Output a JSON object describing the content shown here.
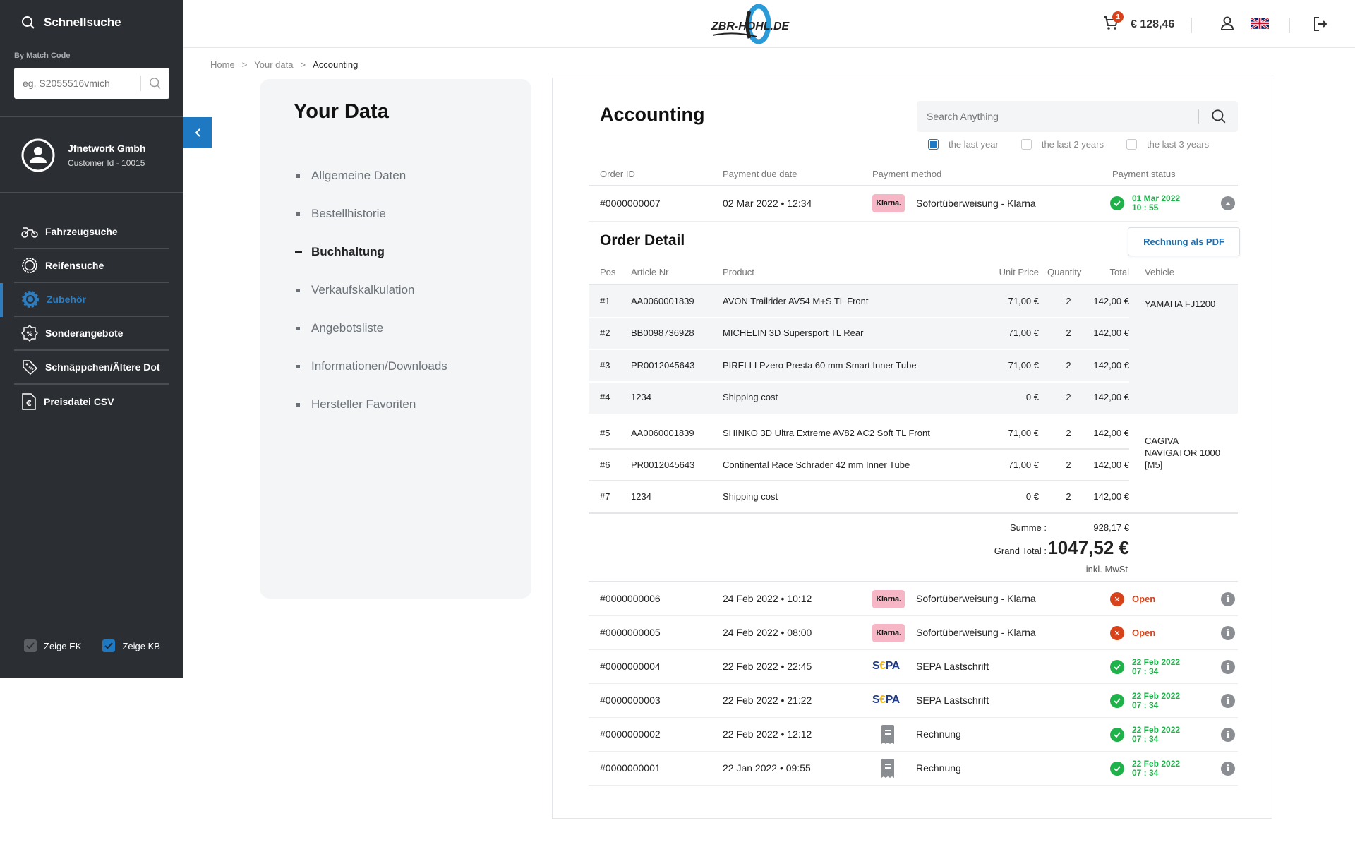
{
  "sidebar": {
    "search_title": "Schnellsuche",
    "match_label": "By Match Code",
    "match_placeholder": "eg. S2055516vmich",
    "profile": {
      "name": "Jfnetwork Gmbh",
      "customer_id": "Customer Id - 10015"
    },
    "nav": [
      {
        "label": "Fahrzeugsuche",
        "icon": "motorcycle-icon",
        "active": false
      },
      {
        "label": "Reifensuche",
        "icon": "tire-icon",
        "active": false
      },
      {
        "label": "Zubehör",
        "icon": "gear-wrench-icon",
        "active": true
      },
      {
        "label": "Sonderangebote",
        "icon": "discount-badge-icon",
        "active": false
      },
      {
        "label": "Schnäppchen/Ältere Dot",
        "icon": "price-tag-icon",
        "active": false
      },
      {
        "label": "Preisdatei CSV",
        "icon": "euro-file-icon",
        "active": false
      }
    ],
    "checkboxes": [
      {
        "label": "Zeige EK",
        "checked": true,
        "color": "#5b5e63"
      },
      {
        "label": "Zeige KB",
        "checked": true,
        "color": "#1e78c2"
      }
    ]
  },
  "header": {
    "logo_text": "ZBR-HOHL.DE",
    "cart_count": "1",
    "cart_amount": "€ 128,46"
  },
  "breadcrumb": [
    "Home",
    "Your data",
    "Accounting"
  ],
  "your_data": {
    "title": "Your Data",
    "menu": [
      {
        "label": "Allgemeine Daten",
        "active": false
      },
      {
        "label": "Bestellhistorie",
        "active": false
      },
      {
        "label": "Buchhaltung",
        "active": true
      },
      {
        "label": "Verkaufskalkulation",
        "active": false
      },
      {
        "label": "Angebotsliste",
        "active": false
      },
      {
        "label": "Informationen/Downloads",
        "active": false
      },
      {
        "label": "Hersteller Favoriten",
        "active": false
      }
    ]
  },
  "accounting": {
    "title": "Accounting",
    "search_placeholder": "Search Anything",
    "filters": [
      {
        "label": "the last year",
        "checked": true
      },
      {
        "label": "the last 2 years",
        "checked": false
      },
      {
        "label": "the last 3 years",
        "checked": false
      }
    ],
    "columns": [
      "Order ID",
      "Payment due date",
      "Payment method",
      "Payment status"
    ],
    "expanded_order": {
      "id": "#0000000007",
      "due": "02 Mar 2022 • 12:34",
      "method_logo": "Klarna.",
      "method": "Sofortüberweisung - Klarna",
      "status": "paid",
      "status_date": "01 Mar 2022",
      "status_time": "10 : 55"
    },
    "detail": {
      "title": "Order Detail",
      "pdf_button": "Rechnung als PDF",
      "columns": [
        "Pos",
        "Article Nr",
        "Product",
        "Unit Price",
        "Quantity",
        "Total",
        "Vehicle"
      ],
      "groups": [
        {
          "vehicle": "YAMAHA FJ1200",
          "items": [
            {
              "pos": "#1",
              "article": "AA0060001839",
              "product": "AVON Trailrider AV54 M+S TL Front",
              "unit": "71,00 €",
              "qty": "2",
              "total": "142,00 €"
            },
            {
              "pos": "#2",
              "article": "BB0098736928",
              "product": "MICHELIN 3D Supersport TL Rear",
              "unit": "71,00 €",
              "qty": "2",
              "total": "142,00 €"
            },
            {
              "pos": "#3",
              "article": "PR0012045643",
              "product": "PIRELLI Pzero Presta 60 mm Smart Inner Tube",
              "unit": "71,00 €",
              "qty": "2",
              "total": "142,00 €"
            },
            {
              "pos": "#4",
              "article": "1234",
              "product": "Shipping cost",
              "unit": "0 €",
              "qty": "2",
              "total": "142,00 €"
            }
          ]
        },
        {
          "vehicle": "CAGIVA NAVIGATOR 1000 [M5]",
          "items": [
            {
              "pos": "#5",
              "article": "AA0060001839",
              "product": "SHINKO 3D Ultra Extreme AV82 AC2 Soft TL Front",
              "unit": "71,00 €",
              "qty": "2",
              "total": "142,00 €"
            },
            {
              "pos": "#6",
              "article": "PR0012045643",
              "product": "Continental Race Schrader 42 mm Inner Tube",
              "unit": "71,00 €",
              "qty": "2",
              "total": "142,00 €"
            },
            {
              "pos": "#7",
              "article": "1234",
              "product": "Shipping cost",
              "unit": "0 €",
              "qty": "2",
              "total": "142,00 €"
            }
          ]
        }
      ],
      "summe_label": "Summe :",
      "summe": "928,17 €",
      "grand_label": "Grand Total :",
      "grand_total": "1047,52 €",
      "vat_note": "inkl. MwSt"
    },
    "orders": [
      {
        "id": "#0000000006",
        "due": "24 Feb 2022 • 10:12",
        "type": "klarna",
        "method": "Sofortüberweisung - Klarna",
        "status": "open",
        "status_label": "Open"
      },
      {
        "id": "#0000000005",
        "due": "24 Feb 2022 • 08:00",
        "type": "klarna",
        "method": "Sofortüberweisung - Klarna",
        "status": "open",
        "status_label": "Open"
      },
      {
        "id": "#0000000004",
        "due": "22 Feb 2022 • 22:45",
        "type": "sepa",
        "method": "SEPA Lastschrift",
        "status": "paid",
        "status_date": "22 Feb 2022",
        "status_time": "07 : 34"
      },
      {
        "id": "#0000000003",
        "due": "22 Feb 2022 • 21:22",
        "type": "sepa",
        "method": "SEPA Lastschrift",
        "status": "paid",
        "status_date": "22 Feb 2022",
        "status_time": "07 : 34"
      },
      {
        "id": "#0000000002",
        "due": "22 Feb 2022 • 12:12",
        "type": "rechnung",
        "method": "Rechnung",
        "status": "paid",
        "status_date": "22 Feb 2022",
        "status_time": "07 : 34"
      },
      {
        "id": "#0000000001",
        "due": "22 Jan 2022 • 09:55",
        "type": "rechnung",
        "method": "Rechnung",
        "status": "paid",
        "status_date": "22 Feb 2022",
        "status_time": "07 : 34"
      }
    ],
    "sepa_logo": {
      "s": "S",
      "e": "€",
      "pa": "PA"
    }
  },
  "colors": {
    "accent": "#1e78c2",
    "paid": "#1fb14a",
    "open": "#d7421b",
    "sidebar_bg": "#2b2e33",
    "klarna_pink": "#f7b6c6"
  }
}
